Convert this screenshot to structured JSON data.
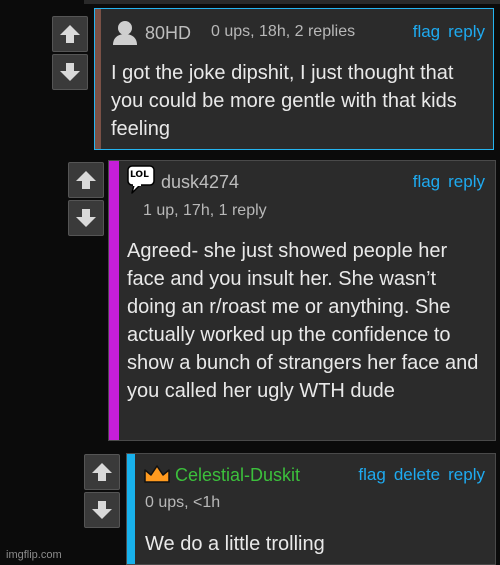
{
  "comments": [
    {
      "username": "80HD",
      "meta": "0 ups, 18h, 2 replies",
      "actions": [
        "flag",
        "reply"
      ],
      "avatar_icon": "user-silhouette-icon",
      "body": "I got the joke dipshit, I just thought that you could be more gentle with that kids feeling",
      "thread_color": "#7a5146",
      "highlight_color": "#25b4f0"
    },
    {
      "username": "dusk4274",
      "meta": "1 up, 17h, 1 reply",
      "actions": [
        "flag",
        "reply"
      ],
      "avatar_icon": "lol-speech-bubble-icon",
      "avatar_text": "LOL",
      "body": "Agreed- she just showed people her face and you insult her. She wasn’t doing an r/roast me or anything. She actually worked up the confidence to show a bunch of strangers her face and you called her ugly WTH dude",
      "thread_color": "#c51ed9"
    },
    {
      "username": "Celestial-Duskit",
      "meta": "0 ups, <1h",
      "actions": [
        "flag",
        "delete",
        "reply"
      ],
      "avatar_icon": "crown-icon",
      "body": "We do a little trolling",
      "thread_color": "#18b1ec",
      "username_color": "#3cc03c"
    }
  ],
  "watermark": "imgflip.com"
}
